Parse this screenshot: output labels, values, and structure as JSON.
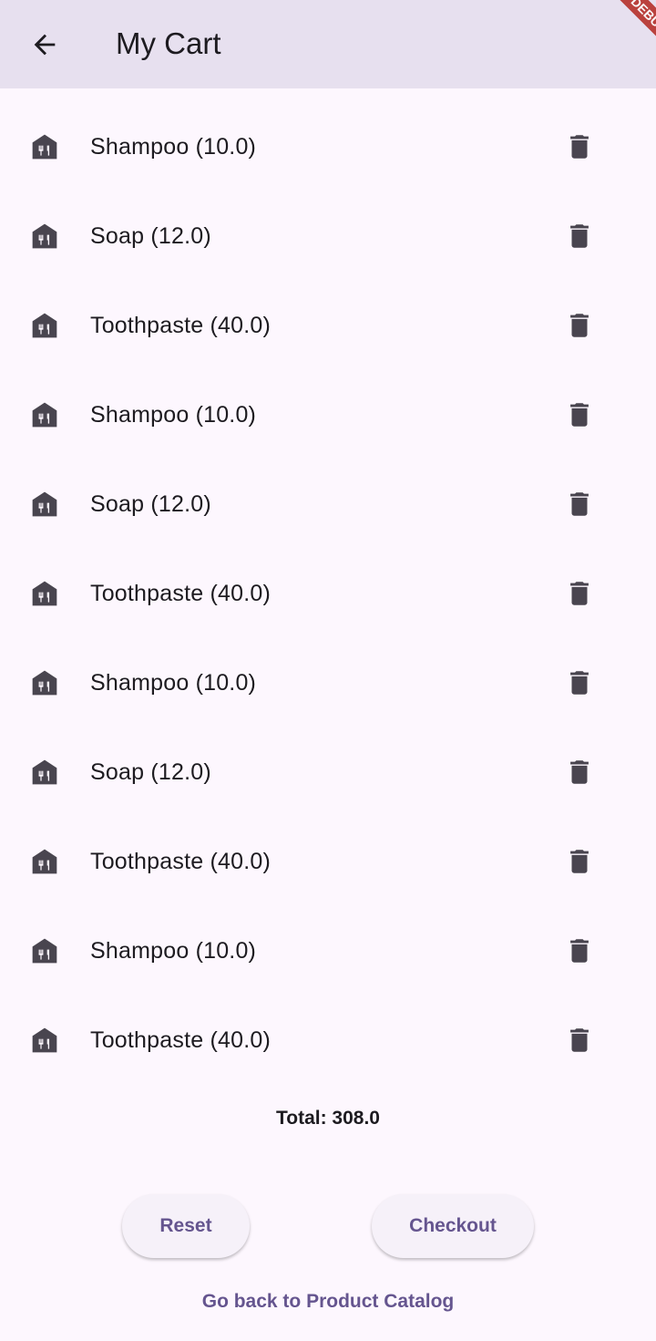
{
  "app_bar": {
    "title": "My Cart",
    "back_icon": "arrow-back-icon",
    "debug_banner": "DEBUG",
    "background": "#e7e0ef"
  },
  "cart": {
    "item_icon": "storefront-icon",
    "delete_icon": "trash-icon",
    "items": [
      {
        "label": "Shampoo (10.0)"
      },
      {
        "label": "Soap (12.0)"
      },
      {
        "label": "Toothpaste (40.0)"
      },
      {
        "label": "Shampoo (10.0)"
      },
      {
        "label": "Soap (12.0)"
      },
      {
        "label": "Toothpaste (40.0)"
      },
      {
        "label": "Shampoo (10.0)"
      },
      {
        "label": "Soap (12.0)"
      },
      {
        "label": "Toothpaste (40.0)"
      },
      {
        "label": "Shampoo (10.0)"
      },
      {
        "label": "Toothpaste (40.0)"
      }
    ]
  },
  "summary": {
    "total": "Total: 308.0"
  },
  "actions": {
    "reset_label": "Reset",
    "checkout_label": "Checkout",
    "back_link_label": "Go back to Product Catalog"
  },
  "colors": {
    "accent": "#65558f",
    "background": "#fdf7fe",
    "icon": "#49454f"
  }
}
